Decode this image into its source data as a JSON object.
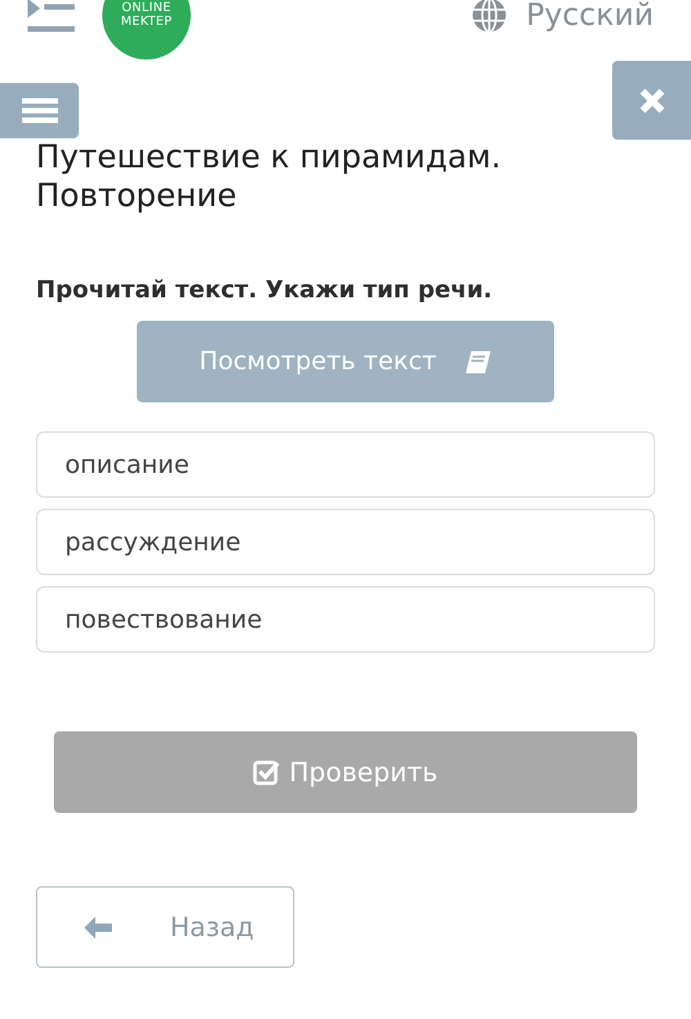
{
  "header": {
    "logo": [
      "ONLINE",
      "MEKTEP"
    ],
    "language": "Русский"
  },
  "title": "Путешествие к пирамидам. Повторение",
  "question": "Прочитай текст. Укажи тип речи.",
  "view_text_button": "Посмотреть текст",
  "options": [
    {
      "label": "описание",
      "selected": false
    },
    {
      "label": "рассуждение",
      "selected": false
    },
    {
      "label": "повествование",
      "selected": false
    }
  ],
  "check_button": {
    "label": "Проверить",
    "disabled": true
  },
  "back_button": "Назад"
}
